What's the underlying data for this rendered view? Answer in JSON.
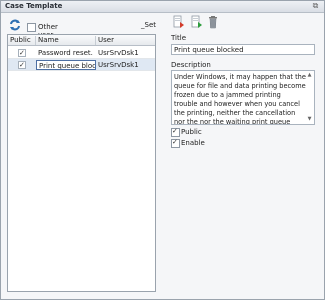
{
  "window": {
    "title": "Case Template",
    "window_control_icon": "restore-icon"
  },
  "toolbar": {
    "refresh_icon": "refresh-icon",
    "other_user_label": "Other user",
    "set_label": "_Set"
  },
  "grid": {
    "columns": [
      "Public",
      "Name",
      "User"
    ],
    "rows": [
      {
        "public": true,
        "name": "Password reset.",
        "user": "UsrSrvDsk1"
      },
      {
        "public": true,
        "name": "Print queue blocked",
        "user": "UsrSrvDsk1"
      }
    ]
  },
  "detail": {
    "toolbar_icons": [
      "delete-record-icon",
      "save-record-icon",
      "trash-icon"
    ],
    "title_label": "Title",
    "title_value": "Print queue blocked",
    "description_label": "Description",
    "description_value": "Under Windows, it may happen that the queue for file and data printing become frozen due to a jammed printing trouble and however when you cancel the printing, neither the cancellation nor the nor the waiting print queue works.",
    "public_label": "Public",
    "public_checked": true,
    "enable_label": "Enable",
    "enable_checked": true
  }
}
